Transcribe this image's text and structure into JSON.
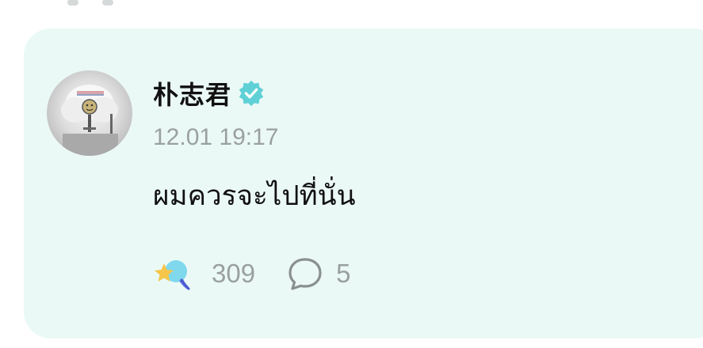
{
  "post": {
    "author": {
      "name": "朴志君",
      "verified": true,
      "verified_color": "#5fd0d6"
    },
    "timestamp": "12.01 19:17",
    "text": "ผมควรจะไปที่นั่น",
    "reactions": {
      "like_icon": "star-planet-icon",
      "like_count": "309",
      "comment_icon": "comment-bubble-icon",
      "comment_count": "5"
    }
  },
  "colors": {
    "card_background": "#ebf9f6",
    "secondary_text": "#9aa0a0",
    "primary_text": "#111111"
  }
}
